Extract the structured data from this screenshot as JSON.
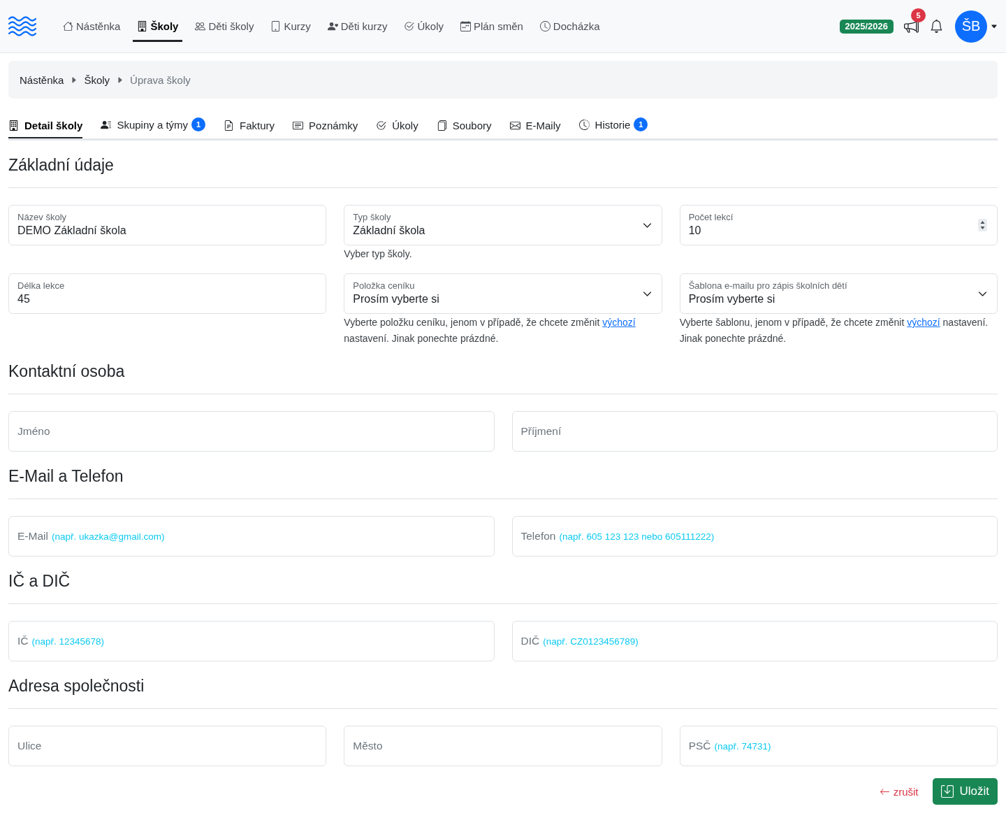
{
  "nav": {
    "items": [
      {
        "label": "Nástěnka",
        "selected": false
      },
      {
        "label": "Školy",
        "selected": true
      },
      {
        "label": "Děti školy",
        "selected": false
      },
      {
        "label": "Kurzy",
        "selected": false
      },
      {
        "label": "Děti kurzy",
        "selected": false
      },
      {
        "label": "Úkoly",
        "selected": false
      },
      {
        "label": "Plán směn",
        "selected": false
      },
      {
        "label": "Docházka",
        "selected": false
      }
    ],
    "season": "2025/2026",
    "announcements_count": "5",
    "avatar_initials": "ŠB"
  },
  "breadcrumb": [
    {
      "label": "Nástěnka",
      "current": false
    },
    {
      "label": "Školy",
      "current": false
    },
    {
      "label": "Úprava školy",
      "current": true
    }
  ],
  "tabs": [
    {
      "label": "Detail školy",
      "selected": true
    },
    {
      "label": "Skupiny a týmy",
      "badge": "1",
      "selected": false
    },
    {
      "label": "Faktury",
      "selected": false
    },
    {
      "label": "Poznámky",
      "selected": false
    },
    {
      "label": "Úkoly",
      "selected": false
    },
    {
      "label": "Soubory",
      "selected": false
    },
    {
      "label": "E-Maily",
      "selected": false
    },
    {
      "label": "Historie",
      "badge": "1",
      "selected": false
    }
  ],
  "sections": [
    {
      "title": "Základní údaje",
      "rows": [
        [
          {
            "kind": "text",
            "label": "Název školy",
            "value": "DEMO Základní škola"
          },
          {
            "kind": "select",
            "label": "Typ školy",
            "value": "Základní škola",
            "help": {
              "text": "Vyber typ školy."
            }
          },
          {
            "kind": "number",
            "label": "Počet lekcí",
            "value": "10"
          }
        ],
        [
          {
            "kind": "text",
            "label": "Délka lekce",
            "value": "45"
          },
          {
            "kind": "select",
            "label": "Položka ceníku",
            "value": "Prosím vyberte si",
            "help": {
              "text": "Vyberte položku ceníku, jenom v případě, že chcete změnit",
              "link": "výchozí",
              "text_after": "nastavení. Jinak ponechte prázdné."
            }
          },
          {
            "kind": "select",
            "label": "Šablona e-mailu pro zápis školních dětí",
            "value": "Prosím vyberte si",
            "help": {
              "text": "Vyberte šablonu, jenom v případě, že chcete změnit",
              "link": "výchozí",
              "text_after": "nastavení. Jinak ponechte prázdné."
            }
          }
        ]
      ]
    },
    {
      "title": "Kontaktní osoba",
      "rows": [
        [
          {
            "kind": "text",
            "placeholder": "Jméno"
          },
          {
            "kind": "text",
            "placeholder": "Příjmení"
          }
        ]
      ]
    },
    {
      "title": "E-Mail a Telefon",
      "rows": [
        [
          {
            "kind": "text",
            "placeholder": "E-Mail",
            "hint": "(např. ukazka@gmail.com)"
          },
          {
            "kind": "text",
            "placeholder": "Telefon",
            "hint": "(např. 605 123 123 nebo 605111222)"
          }
        ]
      ]
    },
    {
      "title": "IČ a DIČ",
      "rows": [
        [
          {
            "kind": "text",
            "placeholder": "IČ",
            "hint": "(např. 12345678)"
          },
          {
            "kind": "text",
            "placeholder": "DIČ",
            "hint": "(např. CZ0123456789)"
          }
        ]
      ]
    },
    {
      "title": "Adresa společnosti",
      "rows": [
        [
          {
            "kind": "text",
            "placeholder": "Ulice"
          },
          {
            "kind": "text",
            "placeholder": "Město"
          },
          {
            "kind": "text",
            "placeholder": "PSČ",
            "hint": "(např. 74731)"
          }
        ]
      ]
    }
  ],
  "actions": {
    "cancel": "zrušit",
    "save": "Uložit"
  }
}
